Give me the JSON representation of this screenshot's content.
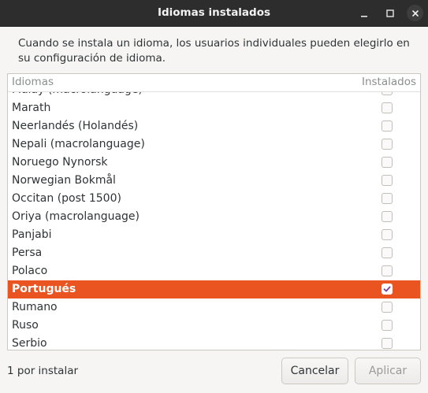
{
  "window": {
    "title": "Idiomas instalados"
  },
  "description": "Cuando se instala un idioma, los usuarios individuales pueden elegirlo en su configuración de idioma.",
  "list": {
    "columns": {
      "language": "Idiomas",
      "installed": "Instalados"
    },
    "rows": [
      {
        "label": "Malay (macrolanguage)",
        "installed": false,
        "selected": false
      },
      {
        "label": "Marath",
        "installed": false,
        "selected": false
      },
      {
        "label": "Neerlandés (Holandés)",
        "installed": false,
        "selected": false
      },
      {
        "label": "Nepali (macrolanguage)",
        "installed": false,
        "selected": false
      },
      {
        "label": "Noruego Nynorsk",
        "installed": false,
        "selected": false
      },
      {
        "label": "Norwegian Bokmål",
        "installed": false,
        "selected": false
      },
      {
        "label": "Occitan (post 1500)",
        "installed": false,
        "selected": false
      },
      {
        "label": "Oriya (macrolanguage)",
        "installed": false,
        "selected": false
      },
      {
        "label": "Panjabi",
        "installed": false,
        "selected": false
      },
      {
        "label": "Persa",
        "installed": false,
        "selected": false
      },
      {
        "label": "Polaco",
        "installed": false,
        "selected": false
      },
      {
        "label": "Portugués",
        "installed": true,
        "selected": true
      },
      {
        "label": "Rumano",
        "installed": false,
        "selected": false
      },
      {
        "label": "Ruso",
        "installed": false,
        "selected": false
      },
      {
        "label": "Serbio",
        "installed": false,
        "selected": false
      }
    ]
  },
  "footer": {
    "status": "1 por instalar",
    "cancel_label": "Cancelar",
    "apply_label": "Aplicar"
  },
  "colors": {
    "selection": "#e95420",
    "titlebar": "#2d2d2d"
  },
  "icons": {
    "minimize": "minimize-icon",
    "maximize": "maximize-icon",
    "close": "close-icon"
  }
}
